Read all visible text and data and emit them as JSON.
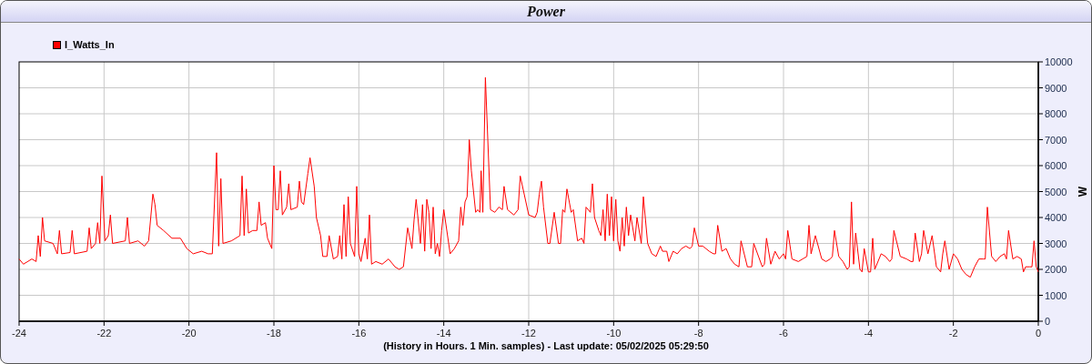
{
  "chart_data": {
    "type": "line",
    "grid": true,
    "title": "Power",
    "xlabel": "(History in Hours. 1 Min. samples) - Last update: 05/02/2025 05:29:50",
    "ylabel": "W",
    "xlim": [
      -24,
      0
    ],
    "ylim": [
      0,
      10000
    ],
    "xticks": [
      -24,
      -22,
      -20,
      -18,
      -16,
      -14,
      -12,
      -10,
      -8,
      -6,
      -4,
      -2,
      0
    ],
    "yticks": [
      0,
      1000,
      2000,
      3000,
      4000,
      5000,
      6000,
      7000,
      8000,
      9000,
      10000
    ],
    "x": [
      -24,
      -23.9,
      -23.7,
      -23.6,
      -23.55,
      -23.5,
      -23.45,
      -23.4,
      -23.2,
      -23.1,
      -23.05,
      -23,
      -22.8,
      -22.75,
      -22.7,
      -22.4,
      -22.35,
      -22.3,
      -22.2,
      -22.15,
      -22.1,
      -22.05,
      -21.98,
      -21.9,
      -21.85,
      -21.8,
      -21.5,
      -21.45,
      -21.4,
      -21.2,
      -21.05,
      -20.95,
      -20.85,
      -20.8,
      -20.75,
      -20.6,
      -20.4,
      -20.2,
      -20.05,
      -19.9,
      -19.7,
      -19.55,
      -19.45,
      -19.35,
      -19.3,
      -19.25,
      -19.2,
      -19,
      -18.8,
      -18.75,
      -18.7,
      -18.65,
      -18.6,
      -18.5,
      -18.4,
      -18.35,
      -18.3,
      -18.2,
      -18.15,
      -18.05,
      -18,
      -17.95,
      -17.9,
      -17.85,
      -17.8,
      -17.7,
      -17.65,
      -17.6,
      -17.45,
      -17.4,
      -17.35,
      -17.3,
      -17.2,
      -17.15,
      -17.05,
      -17,
      -16.9,
      -16.85,
      -16.75,
      -16.7,
      -16.6,
      -16.5,
      -16.45,
      -16.4,
      -16.35,
      -16.3,
      -16.25,
      -16.2,
      -16.1,
      -16.05,
      -16,
      -15.95,
      -15.85,
      -15.8,
      -15.75,
      -15.7,
      -15.6,
      -15.45,
      -15.3,
      -15.15,
      -15.05,
      -14.95,
      -14.85,
      -14.75,
      -14.7,
      -14.65,
      -14.55,
      -14.5,
      -14.45,
      -14.4,
      -14.35,
      -14.3,
      -14.25,
      -14.2,
      -14.15,
      -14.1,
      -14.05,
      -14,
      -13.85,
      -13.75,
      -13.65,
      -13.6,
      -13.55,
      -13.5,
      -13.45,
      -13.4,
      -13.35,
      -13.25,
      -13.2,
      -13.15,
      -13.12,
      -13.08,
      -13.02,
      -12.9,
      -12.8,
      -12.7,
      -12.62,
      -12.58,
      -12.5,
      -12.35,
      -12.25,
      -12.2,
      -12,
      -11.85,
      -11.8,
      -11.75,
      -11.7,
      -11.65,
      -11.55,
      -11.5,
      -11.4,
      -11.3,
      -11.25,
      -11.2,
      -11.15,
      -11.1,
      -11,
      -10.95,
      -10.85,
      -10.75,
      -10.7,
      -10.65,
      -10.55,
      -10.5,
      -10.45,
      -10.35,
      -10.3,
      -10.25,
      -10.2,
      -10.15,
      -10.1,
      -10.05,
      -10,
      -9.95,
      -9.9,
      -9.85,
      -9.8,
      -9.75,
      -9.7,
      -9.65,
      -9.6,
      -9.5,
      -9.45,
      -9.35,
      -9.3,
      -9.2,
      -9.1,
      -9,
      -8.9,
      -8.85,
      -8.75,
      -8.7,
      -8.6,
      -8.5,
      -8.4,
      -8.3,
      -8.2,
      -8.15,
      -8.1,
      -8,
      -7.9,
      -7.75,
      -7.65,
      -7.6,
      -7.55,
      -7.45,
      -7.35,
      -7.25,
      -7.15,
      -7.05,
      -7,
      -6.85,
      -6.75,
      -6.7,
      -6.5,
      -6.45,
      -6.4,
      -6.3,
      -6.2,
      -6.1,
      -6,
      -5.95,
      -5.9,
      -5.8,
      -5.65,
      -5.55,
      -5.45,
      -5.4,
      -5.35,
      -5.25,
      -5.1,
      -5,
      -4.9,
      -4.85,
      -4.8,
      -4.7,
      -4.6,
      -4.5,
      -4.45,
      -4.4,
      -4.35,
      -4.3,
      -4.2,
      -4.15,
      -4.1,
      -4,
      -3.95,
      -3.9,
      -3.85,
      -3.7,
      -3.6,
      -3.5,
      -3.45,
      -3.4,
      -3.25,
      -3.1,
      -3,
      -2.95,
      -2.9,
      -2.8,
      -2.75,
      -2.7,
      -2.6,
      -2.5,
      -2.4,
      -2.3,
      -2.25,
      -2.2,
      -2.1,
      -2,
      -1.9,
      -1.8,
      -1.7,
      -1.6,
      -1.5,
      -1.4,
      -1.3,
      -1.25,
      -1.2,
      -1.1,
      -1,
      -0.9,
      -0.8,
      -0.75,
      -0.7,
      -0.6,
      -0.5,
      -0.4,
      -0.35,
      -0.3,
      -0.2,
      -0.15,
      -0.1,
      -0.05,
      0
    ],
    "series": [
      {
        "name": "I_Watts_In",
        "color": "#ff0000",
        "values": [
          2400,
          2200,
          2400,
          2300,
          3300,
          2500,
          4000,
          3100,
          3000,
          2600,
          3500,
          2600,
          2650,
          3500,
          2600,
          2700,
          3600,
          2800,
          3000,
          3800,
          3000,
          5600,
          3100,
          3300,
          4100,
          3000,
          3100,
          4000,
          3000,
          3100,
          2900,
          3100,
          4900,
          4500,
          3700,
          3500,
          3200,
          3200,
          2800,
          2600,
          2700,
          2600,
          2600,
          6500,
          2900,
          5500,
          3000,
          3100,
          3300,
          5600,
          3300,
          5100,
          3400,
          3500,
          3500,
          4600,
          3700,
          3800,
          3200,
          2800,
          6000,
          4300,
          4300,
          5800,
          4100,
          4400,
          5300,
          4300,
          4400,
          5400,
          4600,
          4500,
          5700,
          6300,
          5200,
          4000,
          3300,
          2500,
          2500,
          3300,
          2400,
          2500,
          3300,
          2400,
          4500,
          2500,
          4800,
          3000,
          2500,
          5200,
          2600,
          2300,
          3200,
          2400,
          4100,
          2200,
          2300,
          2200,
          2400,
          2100,
          2000,
          2100,
          3600,
          2800,
          3900,
          4700,
          3000,
          4500,
          2700,
          4700,
          4200,
          2800,
          4400,
          2600,
          3000,
          2500,
          3500,
          4300,
          2600,
          2800,
          3100,
          4400,
          3700,
          4600,
          4800,
          7000,
          5800,
          4200,
          4300,
          4200,
          5800,
          4200,
          9400,
          4300,
          4200,
          4400,
          4300,
          5200,
          4300,
          4100,
          4300,
          5600,
          4100,
          4000,
          4200,
          4900,
          5400,
          4400,
          3000,
          3000,
          4200,
          3000,
          3000,
          4300,
          4200,
          5100,
          4200,
          4300,
          3100,
          3200,
          3000,
          4400,
          4200,
          5300,
          4000,
          3500,
          3300,
          4300,
          3100,
          4900,
          3300,
          4800,
          3100,
          4700,
          3100,
          2700,
          4000,
          2900,
          4400,
          3300,
          4100,
          3100,
          4000,
          3000,
          4800,
          3000,
          2600,
          2500,
          2900,
          2700,
          2700,
          2300,
          2700,
          2600,
          2800,
          2900,
          2800,
          2900,
          3600,
          2900,
          2900,
          2700,
          2600,
          2600,
          3700,
          2700,
          2800,
          2400,
          2200,
          2100,
          3100,
          2100,
          2100,
          3000,
          2100,
          2200,
          3200,
          2200,
          2700,
          2400,
          2600,
          2400,
          3500,
          2400,
          2300,
          2400,
          2500,
          3700,
          2600,
          3300,
          2400,
          2300,
          2400,
          2500,
          3500,
          2500,
          2300,
          2000,
          2100,
          4600,
          2200,
          3400,
          2000,
          1900,
          2800,
          1900,
          1900,
          3200,
          2000,
          2600,
          2500,
          2300,
          2400,
          3500,
          2500,
          2400,
          2300,
          2300,
          3400,
          2300,
          2600,
          3500,
          2600,
          3300,
          2100,
          1900,
          2600,
          3100,
          2000,
          2600,
          2400,
          2000,
          1800,
          1700,
          2100,
          2400,
          2400,
          2400,
          4400,
          2500,
          2300,
          2500,
          2600,
          2400,
          3500,
          2400,
          2500,
          2400,
          1900,
          2100,
          2100,
          2100,
          3100,
          2100,
          1900
        ]
      }
    ]
  }
}
